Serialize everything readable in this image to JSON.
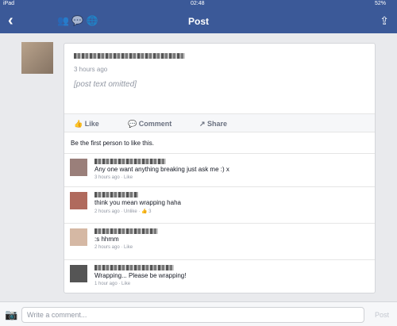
{
  "status": {
    "left": "iPad",
    "time": "02:48",
    "battery": "52%"
  },
  "nav": {
    "title": "Post",
    "back_icon": "chevron-left-icon",
    "share_icon": "share-icon"
  },
  "post": {
    "timestamp": "3 hours ago",
    "text": "",
    "like": "Like",
    "comment": "Comment",
    "share": "Share",
    "likes_summary": "Be the first person to like this."
  },
  "comments": [
    {
      "text": "Any one want anything breaking just ask me :) x",
      "meta": "3 hours ago · Like",
      "color": "#9a7f7a"
    },
    {
      "text": "think you mean wrapping haha",
      "meta": "2 hours ago · Unlike · 👍 3",
      "color": "#b06a5d"
    },
    {
      "text": ":s hhmm",
      "meta": "2 hours ago · Like",
      "color": "#d5b8a4"
    },
    {
      "text": "Wrapping... Please be wrapping!",
      "meta": "1 hour ago · Like",
      "color": "#555555"
    }
  ],
  "composer": {
    "placeholder": "Write a comment...",
    "post_label": "Post"
  }
}
